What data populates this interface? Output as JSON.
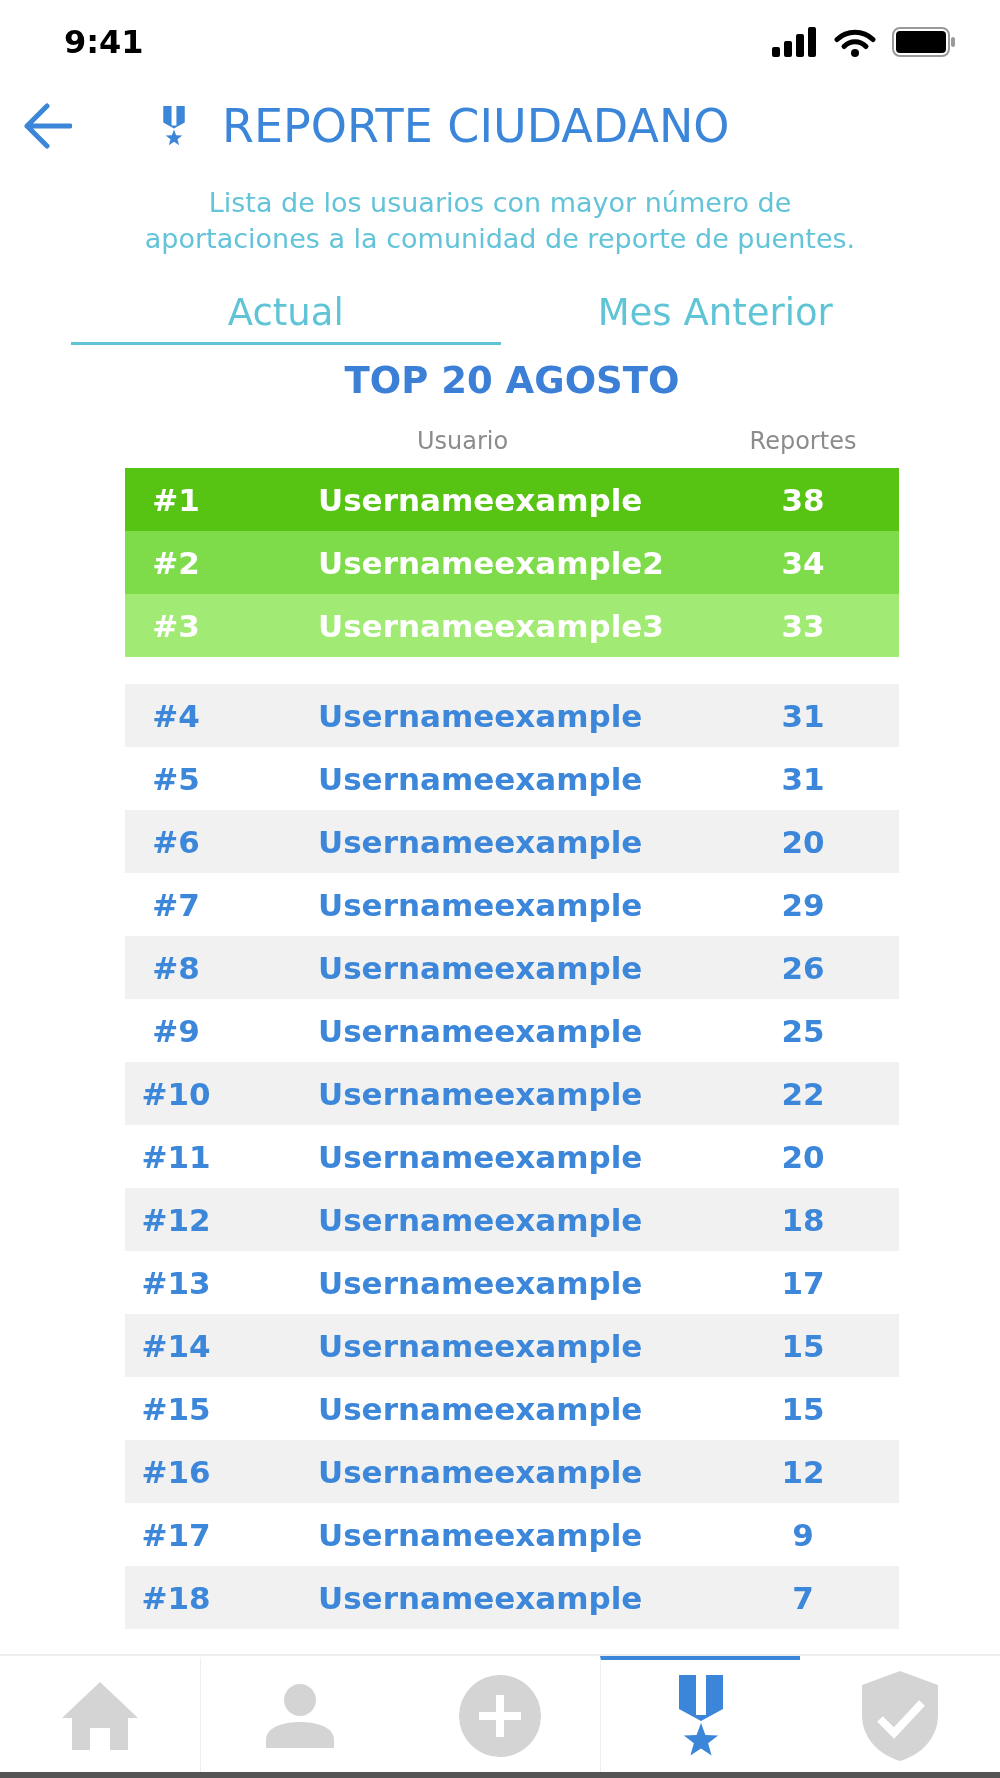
{
  "status_bar": {
    "time": "9:41"
  },
  "header": {
    "title": "REPORTE CIUDADANO",
    "description": "Lista de los usuarios con mayor número de aportaciones a la comunidad de reporte de puentes."
  },
  "tabs": [
    {
      "label": "Actual",
      "selected": true
    },
    {
      "label": "Mes Anterior",
      "selected": false
    }
  ],
  "leaderboard": {
    "title": "TOP 20 AGOSTO",
    "column_headers": {
      "user": "Usuario",
      "reports": "Reportes"
    },
    "podium": [
      {
        "rank": "#1",
        "user": "Usernameexample",
        "reports": "38",
        "color": "#57c414"
      },
      {
        "rank": "#2",
        "user": "Usernameexample2",
        "reports": "34",
        "color": "#7edb4a"
      },
      {
        "rank": "#3",
        "user": "Usernameexample3",
        "reports": "33",
        "color": "#a1ea73"
      }
    ],
    "rows": [
      {
        "rank": "#4",
        "user": "Usernameexample",
        "reports": "31"
      },
      {
        "rank": "#5",
        "user": "Usernameexample",
        "reports": "31"
      },
      {
        "rank": "#6",
        "user": "Usernameexample",
        "reports": "20"
      },
      {
        "rank": "#7",
        "user": "Usernameexample",
        "reports": "29"
      },
      {
        "rank": "#8",
        "user": "Usernameexample",
        "reports": "26"
      },
      {
        "rank": "#9",
        "user": "Usernameexample",
        "reports": "25"
      },
      {
        "rank": "#10",
        "user": "Usernameexample",
        "reports": "22"
      },
      {
        "rank": "#11",
        "user": "Usernameexample",
        "reports": "20"
      },
      {
        "rank": "#12",
        "user": "Usernameexample",
        "reports": "18"
      },
      {
        "rank": "#13",
        "user": "Usernameexample",
        "reports": "17"
      },
      {
        "rank": "#14",
        "user": "Usernameexample",
        "reports": "15"
      },
      {
        "rank": "#15",
        "user": "Usernameexample",
        "reports": "15"
      },
      {
        "rank": "#16",
        "user": "Usernameexample",
        "reports": "12"
      },
      {
        "rank": "#17",
        "user": "Usernameexample",
        "reports": "9"
      },
      {
        "rank": "#18",
        "user": "Usernameexample",
        "reports": "7"
      }
    ]
  },
  "nav": [
    {
      "kind": "home",
      "selected": false
    },
    {
      "kind": "profile",
      "selected": false
    },
    {
      "kind": "add",
      "selected": false
    },
    {
      "kind": "ranking",
      "selected": true
    },
    {
      "kind": "verified",
      "selected": false
    }
  ]
}
